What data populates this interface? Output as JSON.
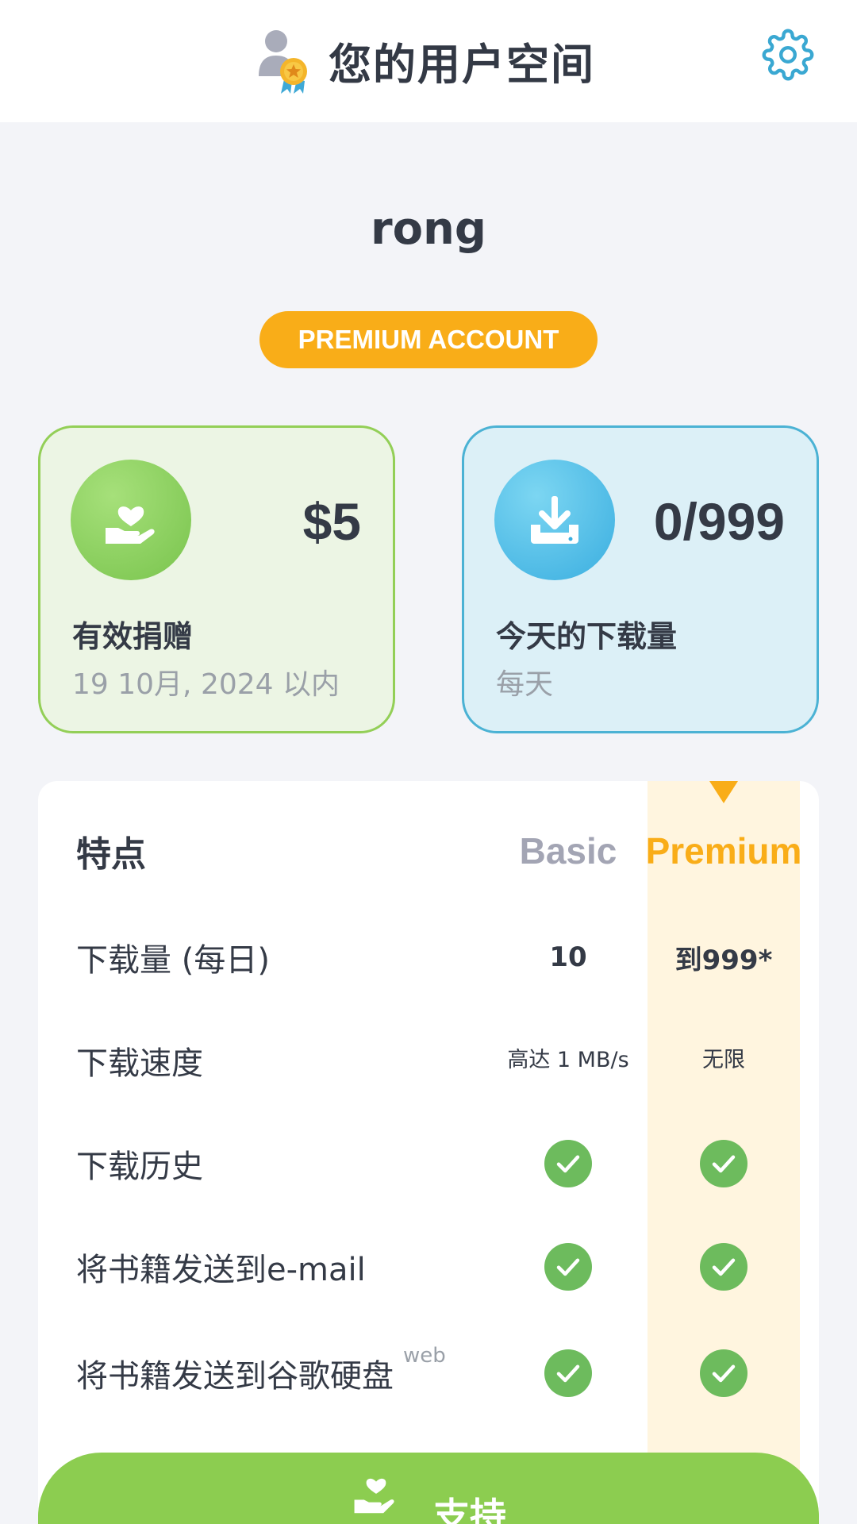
{
  "header": {
    "title": "您的用户空间",
    "user_icon": "user-premium-icon",
    "settings_icon": "gear-icon"
  },
  "profile": {
    "username": "rong",
    "badge": "PREMIUM ACCOUNT"
  },
  "cards": {
    "donation": {
      "icon": "hand-heart-icon",
      "value": "$5",
      "label": "有效捐赠",
      "sub": "19 10月, 2024 以内"
    },
    "downloads": {
      "icon": "download-icon",
      "value": "0/999",
      "label": "今天的下载量",
      "sub": "每天"
    }
  },
  "features": {
    "header": {
      "label": "特点",
      "basic": "Basic",
      "premium": "Premium"
    },
    "rows": [
      {
        "label": "下载量 (每日)",
        "basic": "10",
        "premium": "到999*"
      },
      {
        "label": "下载速度",
        "basic": "高达 1 MB/s",
        "premium": "无限"
      },
      {
        "label": "下载历史",
        "basic": "check",
        "premium": "check"
      },
      {
        "label": "将书籍发送到e-mail",
        "basic": "check",
        "premium": "check"
      },
      {
        "label": "将书籍发送到谷歌硬盘",
        "sup": "web",
        "basic": "check",
        "premium": "check"
      }
    ]
  },
  "support_button": {
    "label": "支持",
    "icon": "hand-heart-icon"
  },
  "colors": {
    "premium_accent": "#f9ad18",
    "donation_green": "#8ccd50",
    "download_blue": "#4bb2d4",
    "check_green": "#6dbb5d",
    "settings_blue": "#3aa8d2"
  }
}
